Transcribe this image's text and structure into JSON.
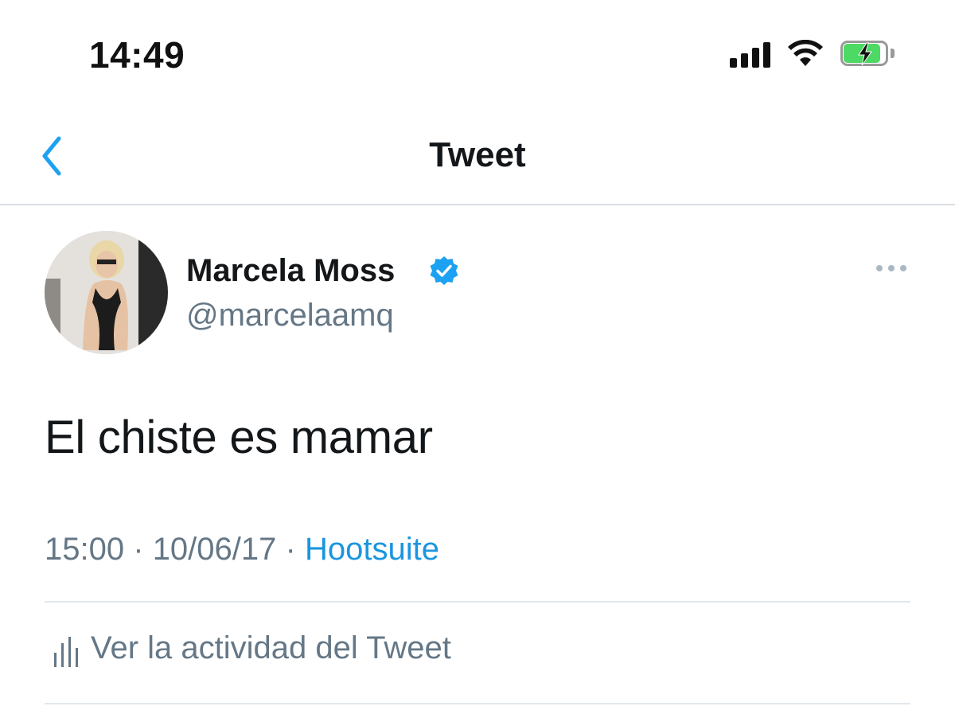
{
  "status_bar": {
    "time": "14:49",
    "icons": [
      "signal-bars-icon",
      "wifi-icon",
      "battery-charging-icon"
    ],
    "battery_color": "#4cd964"
  },
  "nav": {
    "title": "Tweet",
    "back_icon": "chevron-left-icon",
    "accent": "#1da1f2"
  },
  "tweet": {
    "author_name": "Marcela Moss",
    "handle": "@marcelaamq",
    "verified": true,
    "text": "El chiste es mamar",
    "time": "15:00",
    "date": "10/06/17",
    "separator": "·",
    "source": "Hootsuite"
  },
  "activity": {
    "label": "Ver la actividad del Tweet",
    "icon": "analytics-bars-icon"
  },
  "colors": {
    "text_primary": "#14171a",
    "text_secondary": "#657786",
    "link": "#1b95e0",
    "divider": "#e1e8ed"
  }
}
